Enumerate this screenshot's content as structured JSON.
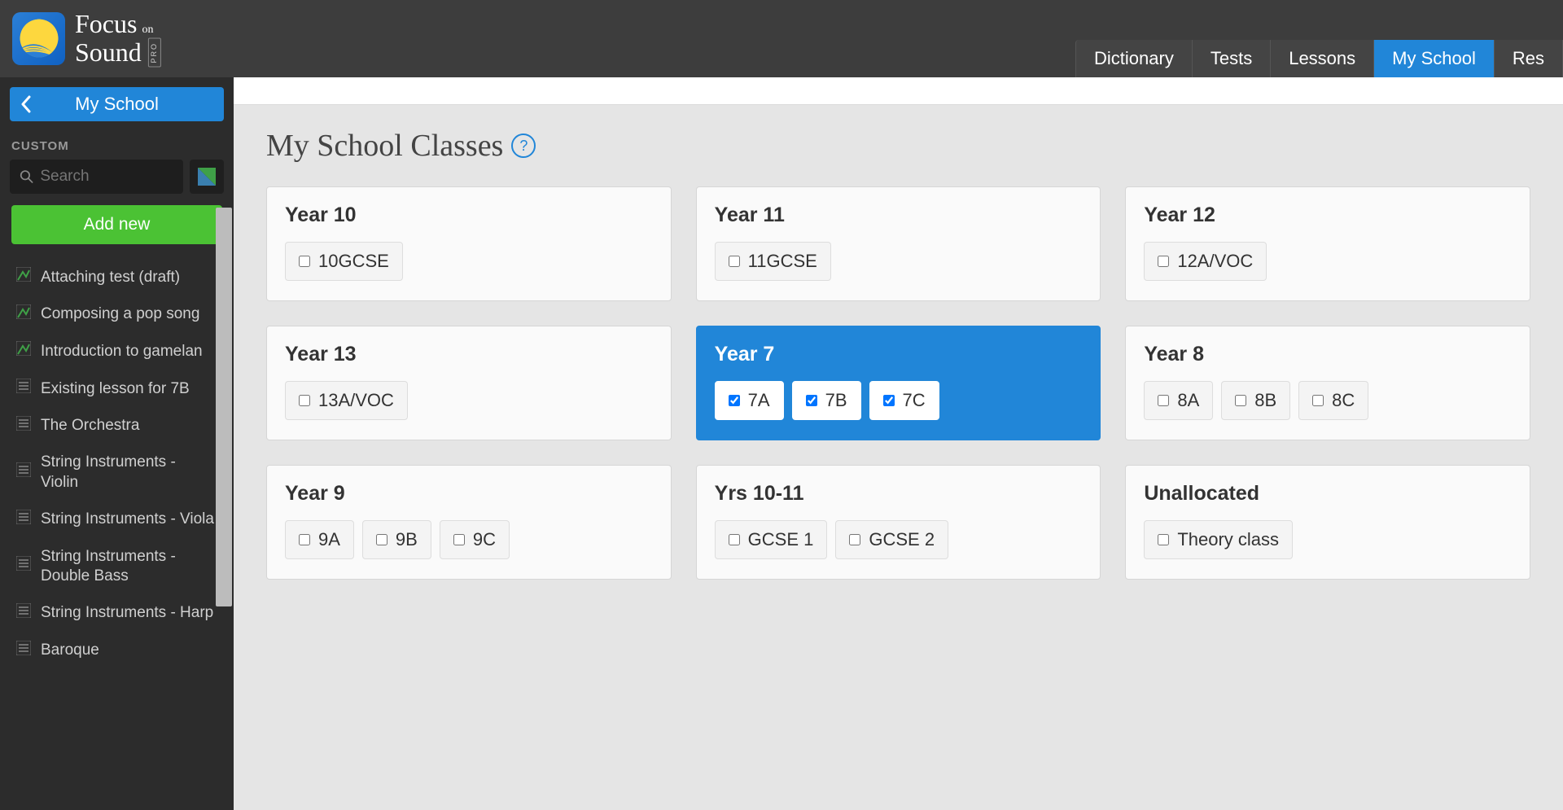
{
  "brand": {
    "line1a": "Focus",
    "line1b": "on",
    "line2": "Sound",
    "pro": "PRO"
  },
  "nav": {
    "items": [
      {
        "label": "Dictionary",
        "active": false
      },
      {
        "label": "Tests",
        "active": false
      },
      {
        "label": "Lessons",
        "active": false
      },
      {
        "label": "My School",
        "active": true
      },
      {
        "label": "Res",
        "active": false
      }
    ]
  },
  "sidebar": {
    "title": "My School",
    "section": "CUSTOM",
    "search_placeholder": "Search",
    "add_new": "Add new",
    "lessons": [
      {
        "label": "Attaching test (draft)",
        "theme": "green"
      },
      {
        "label": "Composing a pop song",
        "theme": "green"
      },
      {
        "label": "Introduction to gamelan",
        "theme": "green"
      },
      {
        "label": "Existing lesson for 7B",
        "theme": "grey"
      },
      {
        "label": "The Orchestra",
        "theme": "grey"
      },
      {
        "label": "String Instruments - Violin",
        "theme": "grey"
      },
      {
        "label": "String Instruments - Viola",
        "theme": "grey"
      },
      {
        "label": "String Instruments - Double Bass",
        "theme": "grey"
      },
      {
        "label": "String Instruments - Harp",
        "theme": "grey"
      },
      {
        "label": "Baroque",
        "theme": "grey"
      }
    ]
  },
  "main": {
    "title": "My School Classes",
    "help": "?",
    "cards": [
      {
        "title": "Year 10",
        "selected": false,
        "chips": [
          {
            "label": "10GCSE",
            "checked": false
          }
        ]
      },
      {
        "title": "Year 11",
        "selected": false,
        "chips": [
          {
            "label": "11GCSE",
            "checked": false
          }
        ]
      },
      {
        "title": "Year 12",
        "selected": false,
        "chips": [
          {
            "label": "12A/VOC",
            "checked": false
          }
        ]
      },
      {
        "title": "Year 13",
        "selected": false,
        "chips": [
          {
            "label": "13A/VOC",
            "checked": false
          }
        ]
      },
      {
        "title": "Year 7",
        "selected": true,
        "chips": [
          {
            "label": "7A",
            "checked": true
          },
          {
            "label": "7B",
            "checked": true
          },
          {
            "label": "7C",
            "checked": true
          }
        ]
      },
      {
        "title": "Year 8",
        "selected": false,
        "chips": [
          {
            "label": "8A",
            "checked": false
          },
          {
            "label": "8B",
            "checked": false
          },
          {
            "label": "8C",
            "checked": false
          }
        ]
      },
      {
        "title": "Year 9",
        "selected": false,
        "chips": [
          {
            "label": "9A",
            "checked": false
          },
          {
            "label": "9B",
            "checked": false
          },
          {
            "label": "9C",
            "checked": false
          }
        ]
      },
      {
        "title": "Yrs 10-11",
        "selected": false,
        "chips": [
          {
            "label": "GCSE 1",
            "checked": false
          },
          {
            "label": "GCSE 2",
            "checked": false
          }
        ]
      },
      {
        "title": "Unallocated",
        "selected": false,
        "chips": [
          {
            "label": "Theory class",
            "checked": false
          }
        ]
      }
    ]
  }
}
